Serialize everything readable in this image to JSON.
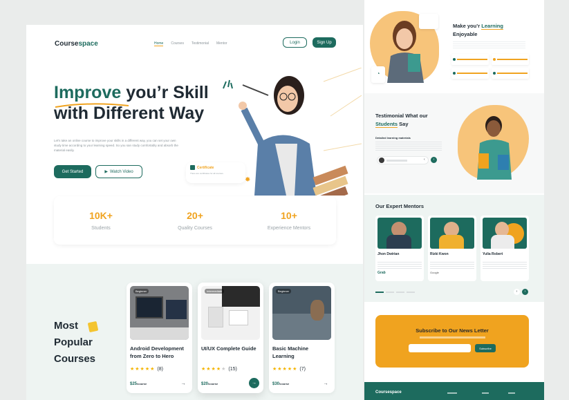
{
  "header": {
    "logo_part1": "Course",
    "logo_part2": "space",
    "nav": [
      "Home",
      "Courses",
      "Testimonial",
      "Mentor"
    ],
    "login": "Login",
    "signup": "Sign Up"
  },
  "hero": {
    "title_word1": "Improve",
    "title_rest": " you’r Skill",
    "title_line2": "with Different Way",
    "description": "Let's take an online course to improve your skills in a different way, you can set your own study time according to your learning speed. So you san study comfortably and absorb the material easily.",
    "cta_primary": "Get Started",
    "cta_secondary": "Watch Video",
    "badge_title": "Certificate",
    "badge_text": "There are certificates for all courses."
  },
  "stats": [
    {
      "value": "10K+",
      "label": "Students"
    },
    {
      "value": "20+",
      "label": "Quality Courses"
    },
    {
      "value": "10+",
      "label": "Experience Mentors"
    }
  ],
  "popular": {
    "line1": "Most",
    "line2": "Popular",
    "line3": "Courses",
    "courses": [
      {
        "tag": "Beginner",
        "title": "Android Development from Zero to Hero",
        "rating": "(8)",
        "stars": 5,
        "price": "$25",
        "unit": "/course"
      },
      {
        "tag": "Intermediate",
        "title": "UI/UX Complete Guide",
        "rating": "(15)",
        "stars": 4,
        "price": "$20",
        "unit": "/course"
      },
      {
        "tag": "Beginner",
        "title": "Basic Machine Learning",
        "rating": "(7)",
        "stars": 5,
        "price": "$30",
        "unit": "/course"
      }
    ]
  },
  "right": {
    "learn_title_part1": "Make you’r ",
    "learn_title_part2": "Learning",
    "learn_title_line2": "Enjoyable",
    "testimonial_line1": "Testimonial What our",
    "testimonial_word": "Students",
    "testimonial_rest": " Say",
    "testimonial_sub": "Detailed learning materials",
    "mentors_title": "Our Expert Mentors",
    "mentors": [
      {
        "name": "Jhon Dwirian",
        "brand": "Grab"
      },
      {
        "name": "Rizki Kwon",
        "brand": "Google"
      },
      {
        "name": "Yulia Robert",
        "brand": ""
      }
    ],
    "newsletter_title": "Subscribe to Our News Letter",
    "newsletter_button": "Subscribe",
    "footer_logo": "Coursespace"
  },
  "colors": {
    "primary": "#1d6b5e",
    "accent": "#f0a31f"
  }
}
